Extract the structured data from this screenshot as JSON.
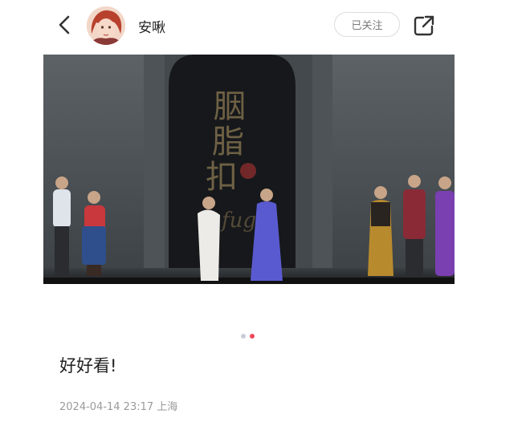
{
  "header": {
    "back_icon": "chevron-left-icon",
    "username": "安啾",
    "follow_label": "已关注",
    "share_icon": "share-icon"
  },
  "post": {
    "image_desc_icon": "stage-photo",
    "image_text": "胭脂扣",
    "carousel": {
      "count": 2,
      "active_index": 1
    },
    "caption": "好好看!",
    "datetime": "2024-04-14 23:17",
    "location": "上海"
  },
  "colors": {
    "dot_active": "#f04a5a",
    "dot_inactive": "#c8cdd6",
    "follow_border": "#dcdcdc"
  }
}
